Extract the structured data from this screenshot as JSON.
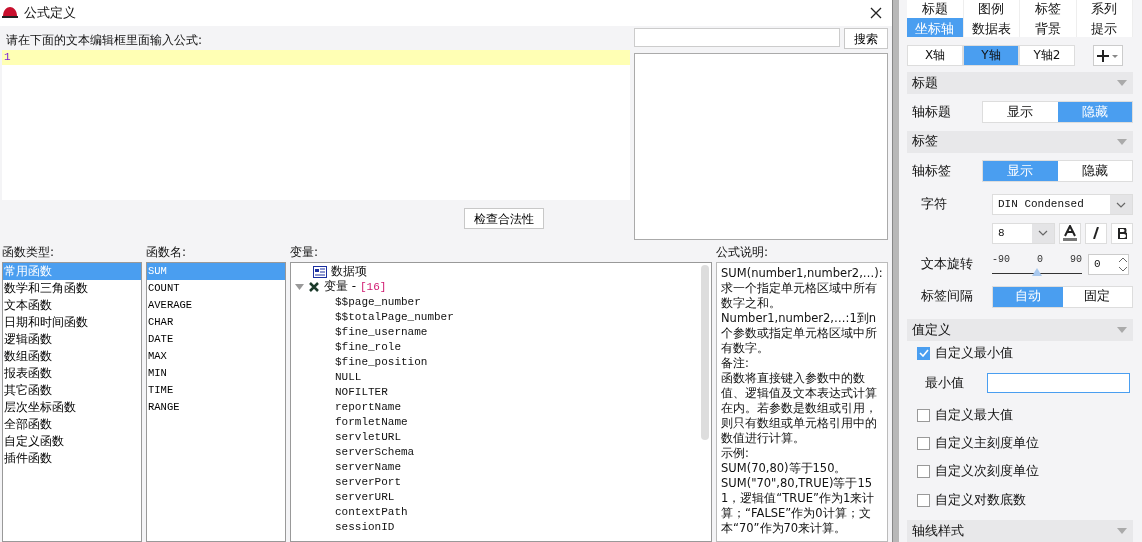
{
  "dialog": {
    "title": "公式定义",
    "editor": {
      "prompt": "请在下面的文本编辑框里面输入公式:",
      "lines": [
        "1"
      ]
    },
    "search": {
      "button": "搜索"
    },
    "check_button": "检查合法性",
    "function_types": {
      "label": "函数类型:",
      "items": [
        {
          "text": "常用函数",
          "selected": true
        },
        {
          "text": "数学和三角函数",
          "selected": false
        },
        {
          "text": "文本函数",
          "selected": false
        },
        {
          "text": "日期和时间函数",
          "selected": false
        },
        {
          "text": "逻辑函数",
          "selected": false
        },
        {
          "text": "数组函数",
          "selected": false
        },
        {
          "text": "报表函数",
          "selected": false
        },
        {
          "text": "其它函数",
          "selected": false
        },
        {
          "text": "层次坐标函数",
          "selected": false
        },
        {
          "text": "全部函数",
          "selected": false
        },
        {
          "text": "自定义函数",
          "selected": false
        },
        {
          "text": "插件函数",
          "selected": false
        }
      ]
    },
    "function_names": {
      "label": "函数名:",
      "items": [
        {
          "text": "SUM",
          "selected": true
        },
        {
          "text": "COUNT",
          "selected": false
        },
        {
          "text": "AVERAGE",
          "selected": false
        },
        {
          "text": "CHAR",
          "selected": false
        },
        {
          "text": "DATE",
          "selected": false
        },
        {
          "text": "MAX",
          "selected": false
        },
        {
          "text": "MIN",
          "selected": false
        },
        {
          "text": "TIME",
          "selected": false
        },
        {
          "text": "RANGE",
          "selected": false
        }
      ]
    },
    "variables": {
      "label": "变量:",
      "tree": [
        {
          "kind": "data",
          "text": "数据项"
        },
        {
          "kind": "group",
          "text": "变量 - ",
          "count": "[16]",
          "expanded": true,
          "children": [
            {
              "text": "$$page_number"
            },
            {
              "text": "$$totalPage_number"
            },
            {
              "text": "$fine_username"
            },
            {
              "text": "$fine_role"
            },
            {
              "text": "$fine_position"
            },
            {
              "text": "NULL"
            },
            {
              "text": "NOFILTER"
            },
            {
              "text": "reportName"
            },
            {
              "text": "formletName"
            },
            {
              "text": "servletURL"
            },
            {
              "text": "serverSchema"
            },
            {
              "text": "serverName"
            },
            {
              "text": "serverPort"
            },
            {
              "text": "serverURL"
            },
            {
              "text": "contextPath"
            },
            {
              "text": "sessionID"
            }
          ]
        }
      ]
    },
    "description": {
      "label": "公式说明:",
      "paragraphs": [
        "SUM(number1,number2,…):求一个指定单元格区域中所有数字之和。",
        "Number1,number2,…:1到n个参数或指定单元格区域中所有数字。",
        "备注:",
        "函数将直接键入参数中的数值、逻辑值及文本表达式计算在内。若参数是数组或引用，则只有数组或单元格引用中的数值进行计算。",
        "示例:",
        "SUM(70,80)等于150。",
        "SUM(\"70\",80,TRUE)等于151，逻辑值“TRUE”作为1来计算；“FALSE”作为0计算；文本“70”作为70来计算。"
      ]
    }
  },
  "panel": {
    "tabs": [
      {
        "label": "标题",
        "selected": false
      },
      {
        "label": "图例",
        "selected": false
      },
      {
        "label": "标签",
        "selected": false
      },
      {
        "label": "系列",
        "selected": false
      },
      {
        "label": "坐标轴",
        "selected": true
      },
      {
        "label": "数据表",
        "selected": false
      },
      {
        "label": "背景",
        "selected": false
      },
      {
        "label": "提示",
        "selected": false
      }
    ],
    "axes": [
      {
        "label": "X轴",
        "selected": false
      },
      {
        "label": "Y轴",
        "selected": true
      },
      {
        "label": "Y轴2",
        "selected": false
      }
    ],
    "title_section": {
      "header": "标题",
      "axis_title": {
        "label": "轴标题",
        "options": [
          {
            "label": "显示",
            "selected": false
          },
          {
            "label": "隐藏",
            "selected": true
          }
        ]
      }
    },
    "label_section": {
      "header": "标签",
      "axis_label": {
        "label": "轴标签",
        "options": [
          {
            "label": "显示",
            "selected": true
          },
          {
            "label": "隐藏",
            "selected": false
          }
        ]
      },
      "font": {
        "label": "字符",
        "value": "DIN Condensed"
      },
      "size": "8",
      "rotation": {
        "label": "文本旋转",
        "min": "-90",
        "mid": "0",
        "max": "90",
        "level": 0.5,
        "value": "0"
      },
      "interval": {
        "label": "标签间隔",
        "options": [
          {
            "label": "自动",
            "selected": true
          },
          {
            "label": "固定",
            "selected": false
          }
        ]
      }
    },
    "value_section": {
      "header": "值定义",
      "options": [
        {
          "label": "自定义最小值",
          "checked": true
        },
        {
          "label": "自定义最大值",
          "checked": false
        },
        {
          "label": "自定义主刻度单位",
          "checked": false
        },
        {
          "label": "自定义次刻度单位",
          "checked": false
        },
        {
          "label": "自定义对数底数",
          "checked": false
        }
      ],
      "min_label": "最小值"
    },
    "axis_line_section": {
      "header": "轴线样式"
    }
  }
}
